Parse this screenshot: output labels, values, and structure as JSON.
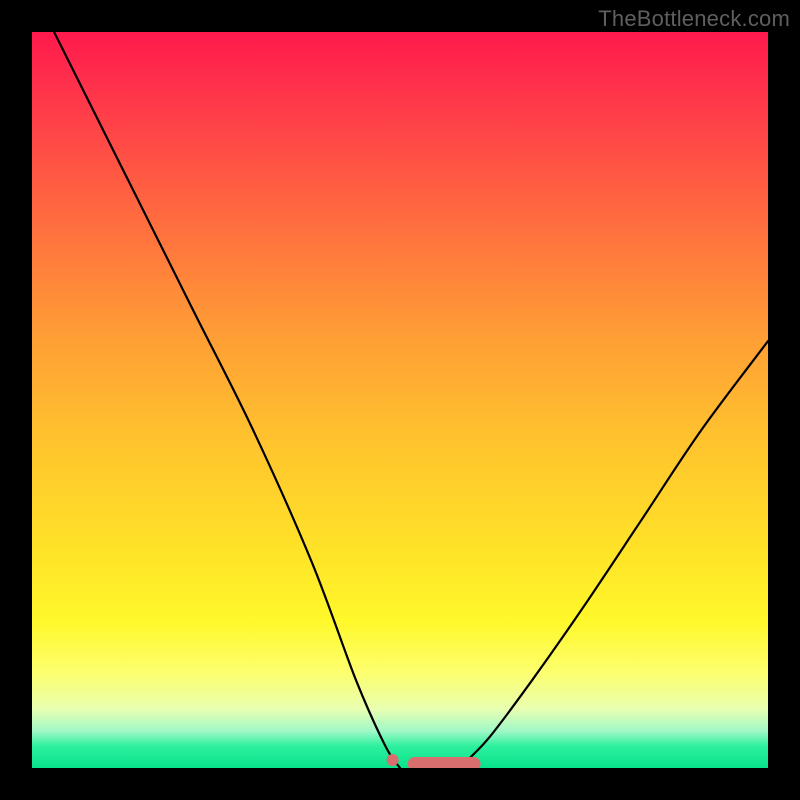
{
  "watermark": "TheBottleneck.com",
  "colors": {
    "frame": "#000000",
    "curve": "#000000",
    "marker": "#d96e6e",
    "gradient_stops": [
      "#ff1a4d",
      "#ff3a4a",
      "#ff6a3f",
      "#ff9a36",
      "#ffc22e",
      "#ffe228",
      "#fff82a",
      "#fdff6e",
      "#e8ffb0",
      "#9ff8c7",
      "#2ef09e",
      "#08e28c"
    ]
  },
  "chart_data": {
    "type": "line",
    "title": "",
    "xlabel": "",
    "ylabel": "",
    "xlim": [
      0,
      100
    ],
    "ylim": [
      0,
      100
    ],
    "grid": false,
    "legend": false,
    "annotations": [
      "TheBottleneck.com"
    ],
    "series": [
      {
        "name": "left-branch",
        "x": [
          3,
          8,
          15,
          22,
          30,
          38,
          44,
          48,
          50
        ],
        "y": [
          100,
          90,
          76,
          62,
          46,
          28,
          12,
          3,
          0
        ]
      },
      {
        "name": "right-branch",
        "x": [
          58,
          62,
          68,
          75,
          83,
          91,
          100
        ],
        "y": [
          0,
          4,
          12,
          22,
          34,
          46,
          58
        ]
      },
      {
        "name": "flat-bottom-markers",
        "x": [
          49,
          52,
          55,
          58,
          60
        ],
        "y": [
          0,
          0,
          0,
          0,
          0
        ]
      }
    ]
  }
}
